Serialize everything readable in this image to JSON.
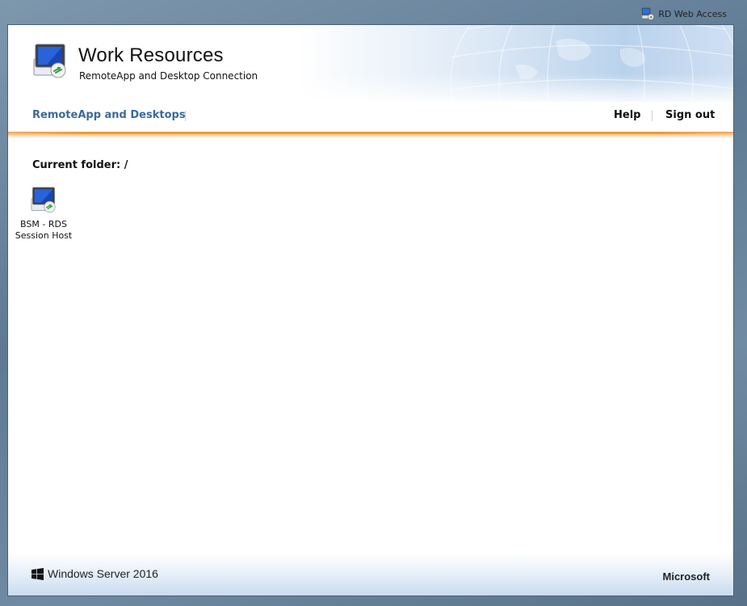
{
  "topbar": {
    "rd_web_access_label": "RD Web Access",
    "icon": "rd-web-access-icon"
  },
  "header": {
    "title": "Work Resources",
    "subtitle": "RemoteApp and Desktop Connection",
    "logo_icon": "remote-desktop-icon"
  },
  "nav": {
    "main_link": "RemoteApp and Desktops",
    "help": "Help",
    "sign_out": "Sign out"
  },
  "content": {
    "current_folder_label": "Current folder: /",
    "resources": [
      {
        "label_line1": "BSM - RDS",
        "label_line2": "Session Host",
        "icon": "remote-desktop-icon"
      }
    ]
  },
  "footer": {
    "product": "Windows Server 2016",
    "vendor": "Microsoft"
  },
  "colors": {
    "nav_link": "#3a6a9a",
    "accent_orange": "#f39a33",
    "background": "#6f8aa2"
  }
}
